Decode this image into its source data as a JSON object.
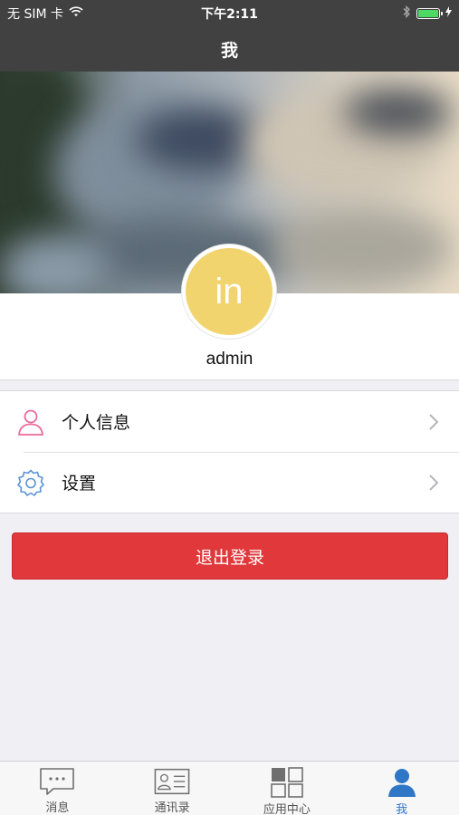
{
  "status_bar": {
    "carrier": "无 SIM 卡",
    "time": "下午2:11",
    "battery_color": "#4cd964"
  },
  "nav": {
    "title": "我"
  },
  "profile": {
    "avatar_initials": "in",
    "avatar_color": "#f2d46e",
    "username": "admin"
  },
  "menu": {
    "items": [
      {
        "label": "个人信息",
        "icon": "person-icon"
      },
      {
        "label": "设置",
        "icon": "gear-icon"
      }
    ]
  },
  "logout": {
    "label": "退出登录",
    "color": "#e0383b"
  },
  "tabs": [
    {
      "label": "消息",
      "icon": "message-icon",
      "active": false
    },
    {
      "label": "通讯录",
      "icon": "contacts-icon",
      "active": false
    },
    {
      "label": "应用中心",
      "icon": "apps-grid-icon",
      "active": false
    },
    {
      "label": "我",
      "icon": "user-icon",
      "active": true
    }
  ],
  "colors": {
    "active_tab": "#2f77c6",
    "dark_bar": "#414141"
  }
}
